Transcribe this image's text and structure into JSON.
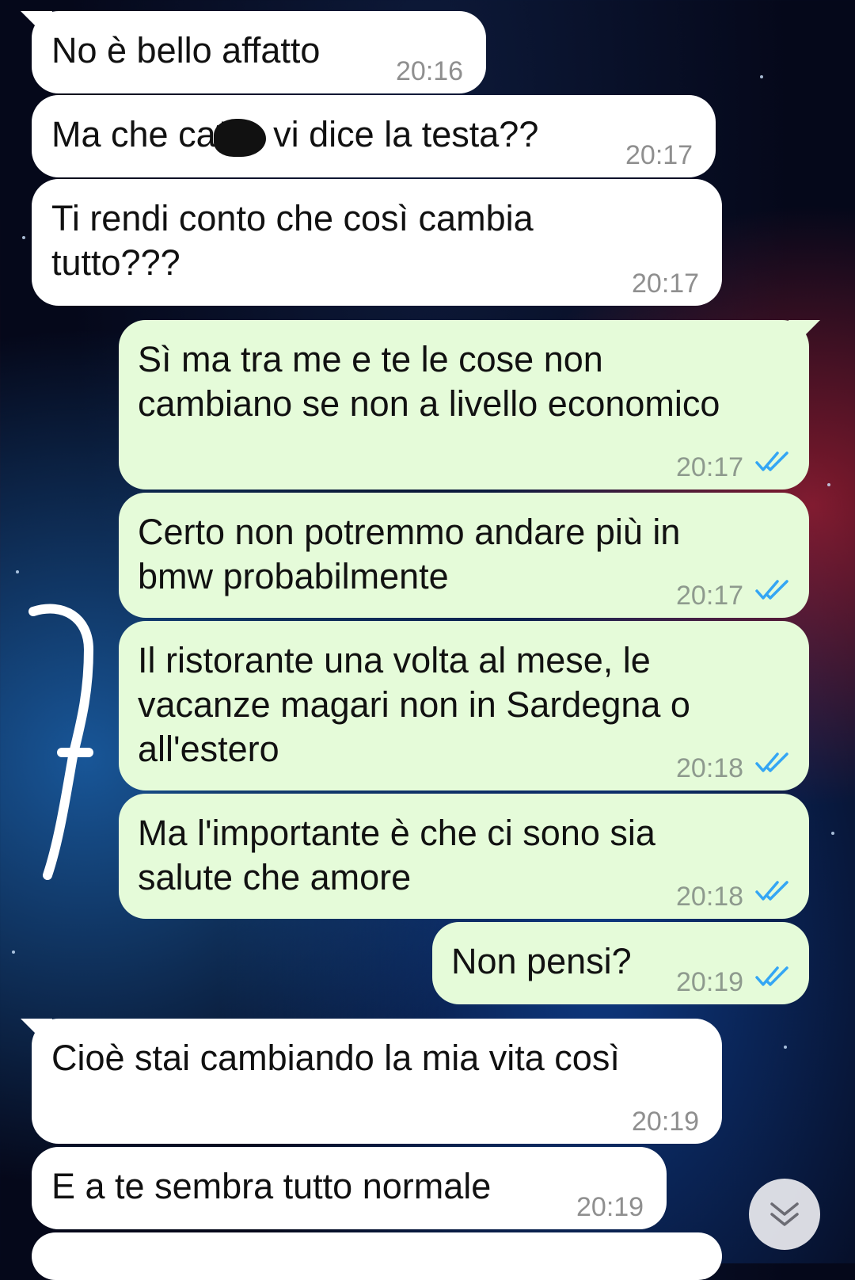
{
  "messages": [
    {
      "direction": "incoming",
      "text": "No è bello affatto",
      "time": "20:16"
    },
    {
      "direction": "incoming",
      "text": "Ma che ca**o vi dice la testa??",
      "time": "20:17"
    },
    {
      "direction": "incoming",
      "text": "Ti rendi conto che così cambia\ntutto???",
      "time": "20:17"
    },
    {
      "direction": "outgoing",
      "text": "Sì ma tra me e te le cose non\ncambiano se non a livello economico",
      "time": "20:17",
      "status": "read"
    },
    {
      "direction": "outgoing",
      "text": "Certo non potremmo andare più in\nbmw probabilmente",
      "time": "20:17",
      "status": "read"
    },
    {
      "direction": "outgoing",
      "text": "Il ristorante una volta al mese, le\nvacanze magari non in Sardegna o\nall'estero",
      "time": "20:18",
      "status": "read"
    },
    {
      "direction": "outgoing",
      "text": "Ma l'importante è che ci sono sia\nsalute che amore",
      "time": "20:18",
      "status": "read"
    },
    {
      "direction": "outgoing",
      "text": "Non pensi?",
      "time": "20:19",
      "status": "read"
    },
    {
      "direction": "incoming",
      "text": "Cioè stai cambiando la mia vita così",
      "time": "20:19"
    },
    {
      "direction": "incoming",
      "text": "E a te sembra tutto normale",
      "time": "20:19"
    }
  ],
  "colors": {
    "incoming_bubble": "#ffffff",
    "outgoing_bubble": "#e5fbd9",
    "read_ticks": "#34a6f4"
  },
  "icons": {
    "read_receipt": "double-check-icon",
    "scroll_down": "chevron-double-down-icon"
  }
}
